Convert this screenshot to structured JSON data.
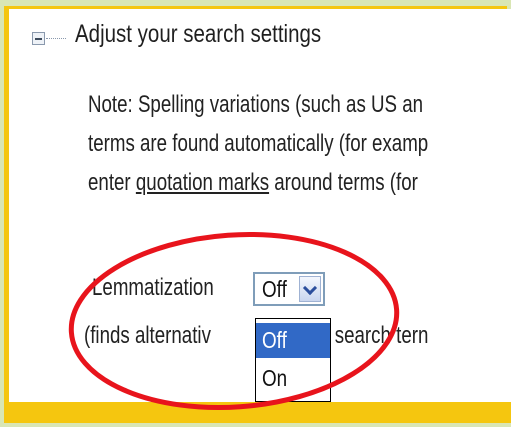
{
  "section": {
    "title": "Adjust your search settings",
    "icon": "collapse-minus-icon"
  },
  "note": {
    "line1": "Note: Spelling variations (such as US an",
    "line2": "terms are found automatically (for examp",
    "line3_pre": "enter ",
    "line3_underlined": "quotation marks",
    "line3_post": " around terms (for"
  },
  "lemmatization": {
    "label": "Lemmatization",
    "selected_value": "Off",
    "options": [
      "Off",
      "On"
    ],
    "help_pre": "(finds alternativ",
    "help_post": "of the search tern"
  },
  "colors": {
    "frame": "#f5c60f",
    "background": "#d9e6b4",
    "selection": "#3169c6",
    "annotation_circle": "#e8141c"
  }
}
